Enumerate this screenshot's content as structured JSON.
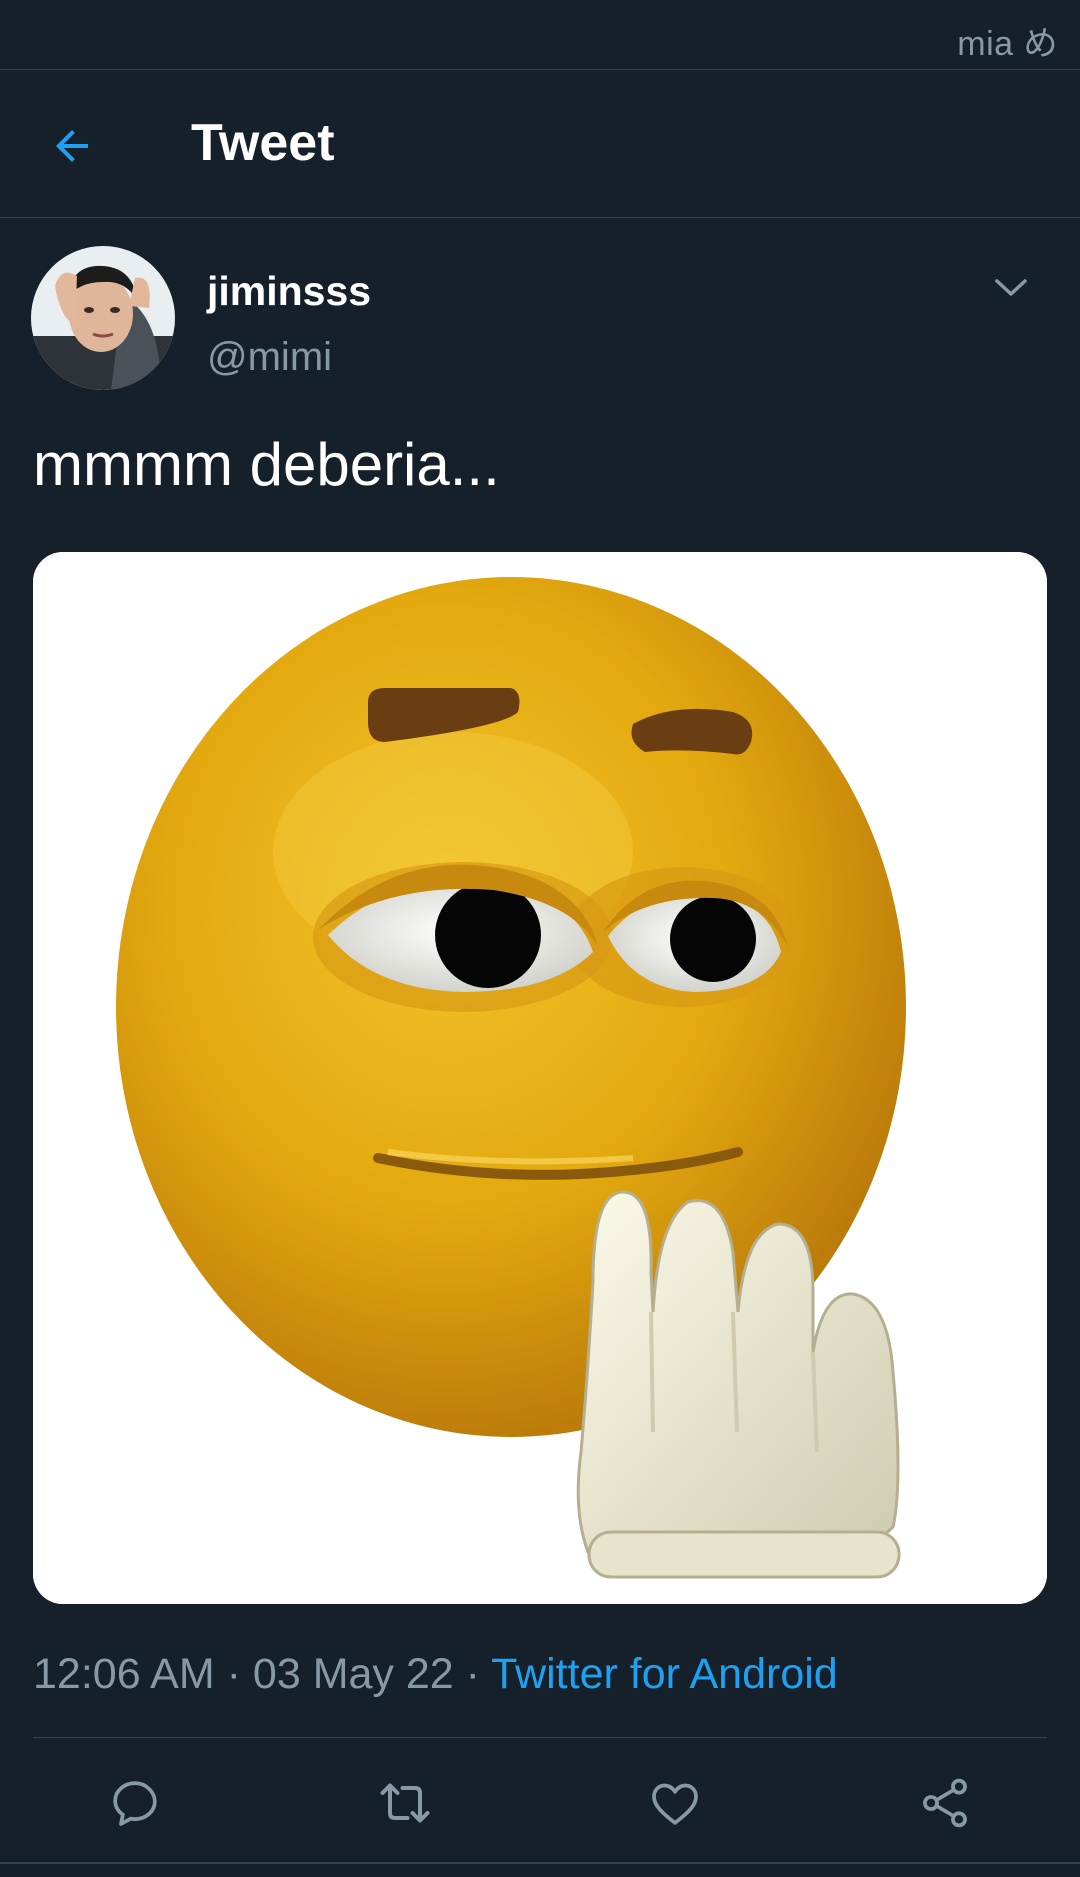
{
  "status_bar": {
    "watermark": "mia め"
  },
  "header": {
    "title": "Tweet"
  },
  "tweet": {
    "display_name": "jiminsss",
    "handle": "@mimi",
    "text": "mmmm deberia...",
    "time": "12:06 AM",
    "date": "03 May 22",
    "separator": "·",
    "source": "Twitter for Android"
  },
  "colors": {
    "background": "#15202b",
    "accent": "#1da1f2",
    "muted": "#8899a6",
    "divider": "#38444d"
  },
  "icons": {
    "back": "arrow-left-icon",
    "caret": "chevron-down-icon",
    "reply": "reply-icon",
    "retweet": "retweet-icon",
    "like": "heart-icon",
    "share": "share-icon"
  }
}
